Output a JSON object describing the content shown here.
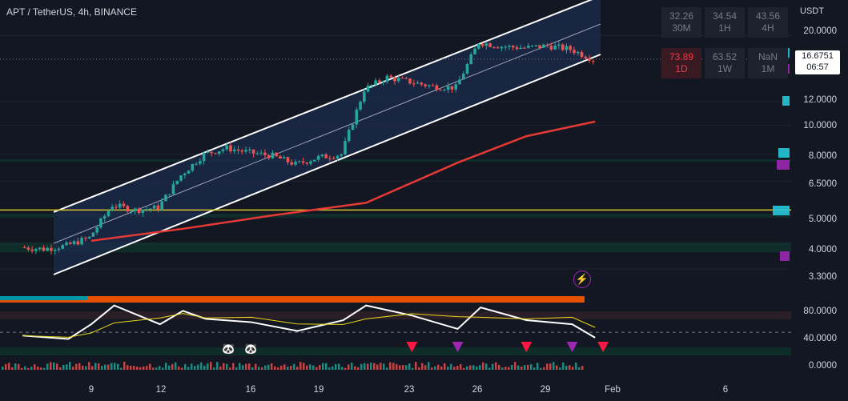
{
  "header": {
    "title": "APT / TetherUS, 4h, BINANCE"
  },
  "axis": {
    "unit": "USDT",
    "price_ticks": [
      "20.0000",
      "12.0000",
      "10.0000",
      "8.0000",
      "6.5000",
      "5.0000",
      "4.0000",
      "3.3000"
    ],
    "osc_ticks": [
      "80.0000",
      "40.0000",
      "0.0000"
    ],
    "x_ticks": [
      "9",
      "12",
      "16",
      "19",
      "23",
      "26",
      "29",
      "Feb",
      "6"
    ]
  },
  "price_tag": {
    "price": "16.6751",
    "countdown": "06:57"
  },
  "mtf_table": [
    {
      "value": "32.26",
      "tf": "30M",
      "hot": false
    },
    {
      "value": "34.54",
      "tf": "1H",
      "hot": false
    },
    {
      "value": "43.56",
      "tf": "4H",
      "hot": false
    },
    {
      "value": "73.89",
      "tf": "1D",
      "hot": true
    },
    {
      "value": "63.52",
      "tf": "1W",
      "hot": false
    },
    {
      "value": "NaN",
      "tf": "1M",
      "hot": false
    }
  ],
  "icons": {
    "bolt": "lightning-icon",
    "panda": "panda-icon",
    "signal_down": "triangle-down-icon"
  },
  "colors": {
    "background": "#131722",
    "up": "#26a69a",
    "down": "#ef5350",
    "channel": "#ffffff",
    "ma": "#f7931a",
    "ma_low": "#e53935",
    "hline": "#d4c52a",
    "rsi": "#ffffff",
    "rsi_ma": "#e6d71a",
    "signal_red": "#ff1744",
    "signal_purple": "#9c27b0"
  },
  "chart_data": {
    "type": "candlestick",
    "symbol": "APT / TetherUS",
    "timeframe": "4h",
    "exchange": "BINANCE",
    "scale": "log",
    "y_range": [
      3.2,
      24
    ],
    "last_price": 16.6751,
    "horizontal_level": 5.2,
    "close_path": [
      {
        "x": "Jan 6",
        "y": 3.9
      },
      {
        "x": "Jan 7",
        "y": 3.85
      },
      {
        "x": "Jan 8",
        "y": 3.95
      },
      {
        "x": "Jan 9",
        "y": 4.2
      },
      {
        "x": "Jan 10",
        "y": 5.4
      },
      {
        "x": "Jan 11",
        "y": 5.2
      },
      {
        "x": "Jan 12",
        "y": 5.3
      },
      {
        "x": "Jan 13",
        "y": 6.8
      },
      {
        "x": "Jan 14",
        "y": 8.0
      },
      {
        "x": "Jan 15",
        "y": 8.4
      },
      {
        "x": "Jan 16",
        "y": 8.1
      },
      {
        "x": "Jan 17",
        "y": 7.9
      },
      {
        "x": "Jan 18",
        "y": 7.4
      },
      {
        "x": "Jan 19",
        "y": 7.8
      },
      {
        "x": "Jan 20",
        "y": 8.0
      },
      {
        "x": "Jan 21",
        "y": 13.2
      },
      {
        "x": "Jan 22",
        "y": 14.5
      },
      {
        "x": "Jan 23",
        "y": 14.0
      },
      {
        "x": "Jan 24",
        "y": 13.5
      },
      {
        "x": "Jan 25",
        "y": 13.4
      },
      {
        "x": "Jan 26",
        "y": 19.0
      },
      {
        "x": "Jan 27",
        "y": 18.4
      },
      {
        "x": "Jan 28",
        "y": 18.2
      },
      {
        "x": "Jan 29",
        "y": 18.5
      },
      {
        "x": "Jan 30",
        "y": 18.0
      },
      {
        "x": "Jan 31",
        "y": 16.6751
      }
    ],
    "moving_average": [
      {
        "x": "Jan 9",
        "y": 4.1
      },
      {
        "x": "Jan 13",
        "y": 4.5
      },
      {
        "x": "Jan 17",
        "y": 5.0
      },
      {
        "x": "Jan 21",
        "y": 5.5
      },
      {
        "x": "Jan 25",
        "y": 7.5
      },
      {
        "x": "Jan 28",
        "y": 9.2
      },
      {
        "x": "Jan 31",
        "y": 10.3
      }
    ],
    "oscillator": {
      "y_range": [
        -5,
        100
      ],
      "rsi": [
        {
          "x": "Jan 6",
          "y": 45
        },
        {
          "x": "Jan 8",
          "y": 40
        },
        {
          "x": "Jan 9",
          "y": 62
        },
        {
          "x": "Jan 10",
          "y": 90
        },
        {
          "x": "Jan 12",
          "y": 62
        },
        {
          "x": "Jan 13",
          "y": 82
        },
        {
          "x": "Jan 14",
          "y": 70
        },
        {
          "x": "Jan 16",
          "y": 65
        },
        {
          "x": "Jan 18",
          "y": 52
        },
        {
          "x": "Jan 20",
          "y": 68
        },
        {
          "x": "Jan 21",
          "y": 90
        },
        {
          "x": "Jan 23",
          "y": 75
        },
        {
          "x": "Jan 25",
          "y": 55
        },
        {
          "x": "Jan 26",
          "y": 87
        },
        {
          "x": "Jan 28",
          "y": 68
        },
        {
          "x": "Jan 30",
          "y": 62
        },
        {
          "x": "Jan 31",
          "y": 42
        }
      ],
      "signals": [
        {
          "x": "Jan 23",
          "type": "sell",
          "color": "red"
        },
        {
          "x": "Jan 25",
          "type": "sell",
          "color": "purple"
        },
        {
          "x": "Jan 28",
          "type": "sell",
          "color": "red"
        },
        {
          "x": "Jan 30",
          "type": "sell",
          "color": "purple"
        },
        {
          "x": "Jan 31",
          "type": "sell",
          "color": "red"
        }
      ]
    }
  }
}
